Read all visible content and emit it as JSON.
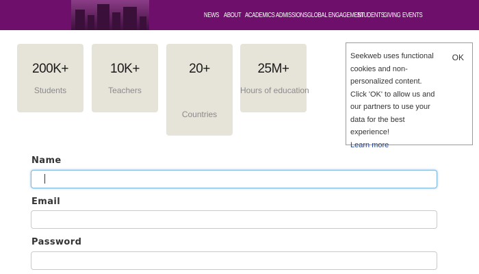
{
  "nav": {
    "items": [
      "NEWS",
      "ABOUT",
      "ACADEMICS",
      "ADMISSIONS",
      "GLOBAL ENGAGEMENT",
      "STUDENTS",
      "GIVING",
      "EVENTS"
    ]
  },
  "stats": [
    {
      "value": "200K+",
      "label": "Students"
    },
    {
      "value": "10K+",
      "label": "Teachers"
    },
    {
      "value": "20+",
      "label": "Countries"
    },
    {
      "value": "25M+",
      "label": "Hours of education"
    }
  ],
  "cookie": {
    "message": "Seekweb uses functional cookies and non-personalized content. Click 'OK' to allow us and our partners to use your data for the best experience!",
    "learn_more": "Learn more",
    "ok": "OK"
  },
  "form": {
    "name_label": "Name",
    "name_value": "",
    "email_label": "Email",
    "email_value": "",
    "password_label": "Password",
    "password_value": ""
  },
  "colors": {
    "brand": "#6e0f6b",
    "card_bg": "#e6e3d9",
    "link": "#1a3fa0",
    "focus": "#7fb6de"
  }
}
